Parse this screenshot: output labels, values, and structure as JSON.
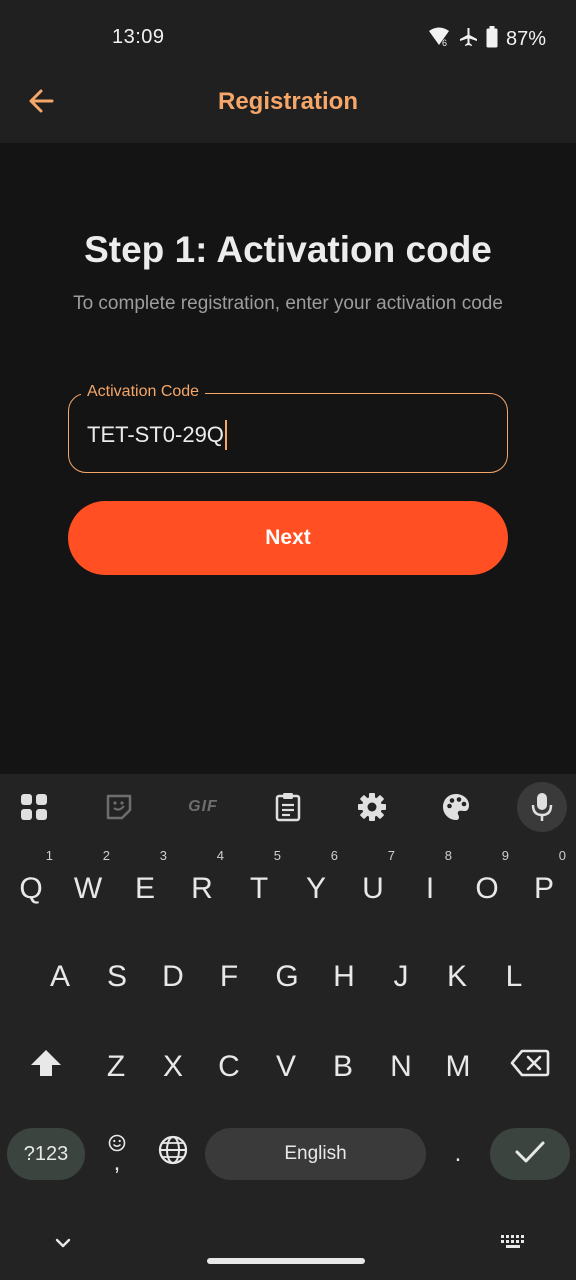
{
  "status_bar": {
    "time": "13:09",
    "battery": "87%"
  },
  "app_bar": {
    "title": "Registration"
  },
  "main": {
    "heading": "Step 1: Activation code",
    "subheading": "To complete registration, enter your activation code",
    "field_label": "Activation Code",
    "field_value": "TET-ST0-29Q",
    "next_label": "Next"
  },
  "keyboard": {
    "toolbar": [
      "apps-icon",
      "sticker-icon",
      "GIF",
      "clipboard-icon",
      "settings-icon",
      "palette-icon",
      "mic-icon"
    ],
    "gif_label": "GIF",
    "row1": [
      "Q",
      "W",
      "E",
      "R",
      "T",
      "Y",
      "U",
      "I",
      "O",
      "P"
    ],
    "row1_hints": [
      "1",
      "2",
      "3",
      "4",
      "5",
      "6",
      "7",
      "8",
      "9",
      "0"
    ],
    "row2": [
      "A",
      "S",
      "D",
      "F",
      "G",
      "H",
      "J",
      "K",
      "L"
    ],
    "row3": [
      "Z",
      "X",
      "C",
      "V",
      "B",
      "N",
      "M"
    ],
    "symbols_label": "?123",
    "comma_label": ",",
    "space_label": "English",
    "period_label": "."
  },
  "colors": {
    "accent": "#f5a668",
    "button": "#ff4f23",
    "background": "#141414",
    "bar": "#202020",
    "keyboard": "#232323"
  }
}
